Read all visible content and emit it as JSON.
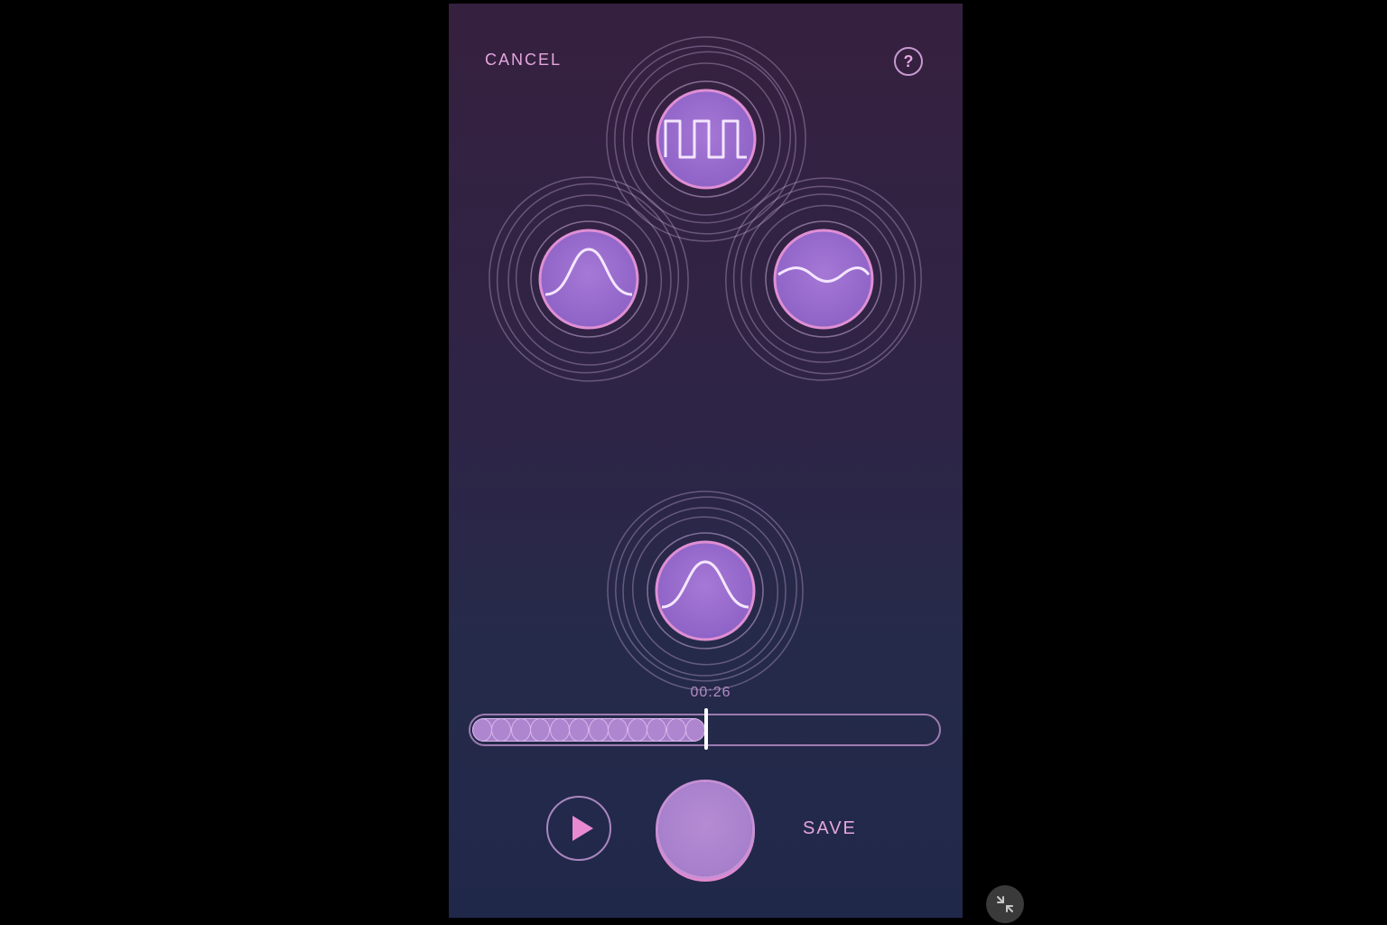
{
  "header": {
    "cancel_label": "CANCEL",
    "help_label": "?"
  },
  "patterns": [
    {
      "name": "pulse-pattern",
      "icon": "square-wave-icon"
    },
    {
      "name": "wave-pattern",
      "icon": "bell-wave-icon"
    },
    {
      "name": "ripple-pattern",
      "icon": "sine-wave-icon"
    }
  ],
  "active_pattern": {
    "icon": "bell-wave-icon"
  },
  "timeline": {
    "time": "00:26",
    "progress_fraction": 0.5,
    "segments": 12
  },
  "controls": {
    "play_icon": "play-icon",
    "save_label": "SAVE",
    "shrink_icon": "shrink-icon"
  },
  "colors": {
    "accent_pink": "#e4a6dc",
    "button_purple": "#9a6ccc"
  }
}
